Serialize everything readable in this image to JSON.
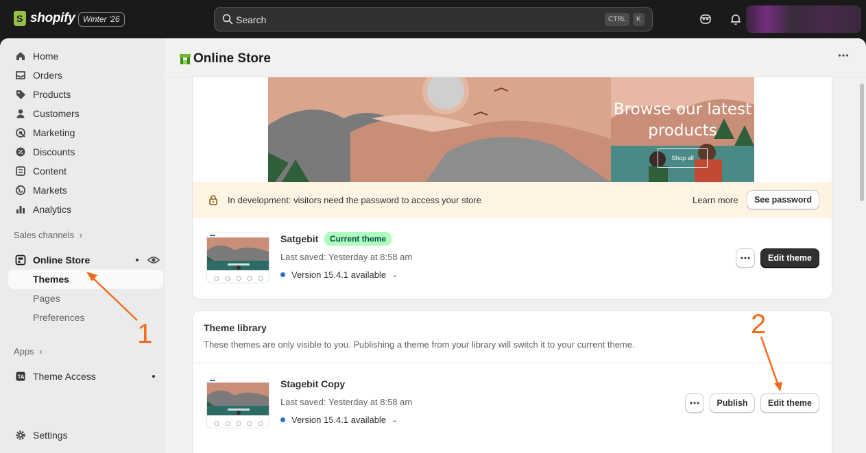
{
  "topbar": {
    "brand": "shopify",
    "edition": "Winter '26",
    "search_placeholder": "Search",
    "shortcut_ctrl": "CTRL",
    "shortcut_k": "K",
    "icons": [
      "sidekick-icon",
      "bell-icon"
    ]
  },
  "sidebar": {
    "items": [
      {
        "label": "Home",
        "icon": "home-icon"
      },
      {
        "label": "Orders",
        "icon": "orders-icon"
      },
      {
        "label": "Products",
        "icon": "tag-icon"
      },
      {
        "label": "Customers",
        "icon": "person-icon"
      },
      {
        "label": "Marketing",
        "icon": "target-icon"
      },
      {
        "label": "Discounts",
        "icon": "discount-icon"
      },
      {
        "label": "Content",
        "icon": "content-icon"
      },
      {
        "label": "Markets",
        "icon": "globe-icon"
      },
      {
        "label": "Analytics",
        "icon": "chart-icon"
      }
    ],
    "sales_channels_label": "Sales channels",
    "online_store": "Online Store",
    "online_store_sub": [
      "Themes",
      "Pages",
      "Preferences"
    ],
    "apps_label": "Apps",
    "theme_access": "Theme Access",
    "settings": "Settings"
  },
  "page": {
    "title": "Online Store",
    "preview": {
      "headline_line1": "Browse our latest",
      "headline_line2": "products",
      "cta": "Shop all"
    },
    "banner": {
      "text": "In development: visitors need the password to access your store",
      "learn_more": "Learn more",
      "see_password": "See password"
    },
    "current_theme": {
      "name": "Satgebit",
      "badge": "Current theme",
      "last_saved": "Last saved: Yesterday at 8:58 am",
      "version": "Version 15.4.1 available",
      "edit_label": "Edit theme"
    },
    "library": {
      "title": "Theme library",
      "description": "These themes are only visible to you. Publishing a theme from your library will switch it to your current theme.",
      "theme": {
        "name": "Stagebit Copy",
        "last_saved": "Last saved: Yesterday at 8:58 am",
        "version": "Version 15.4.1 available",
        "publish_label": "Publish",
        "edit_label": "Edit theme"
      }
    }
  },
  "annotations": {
    "marker_1": "1",
    "marker_2": "2",
    "color": "#f26b1d"
  }
}
